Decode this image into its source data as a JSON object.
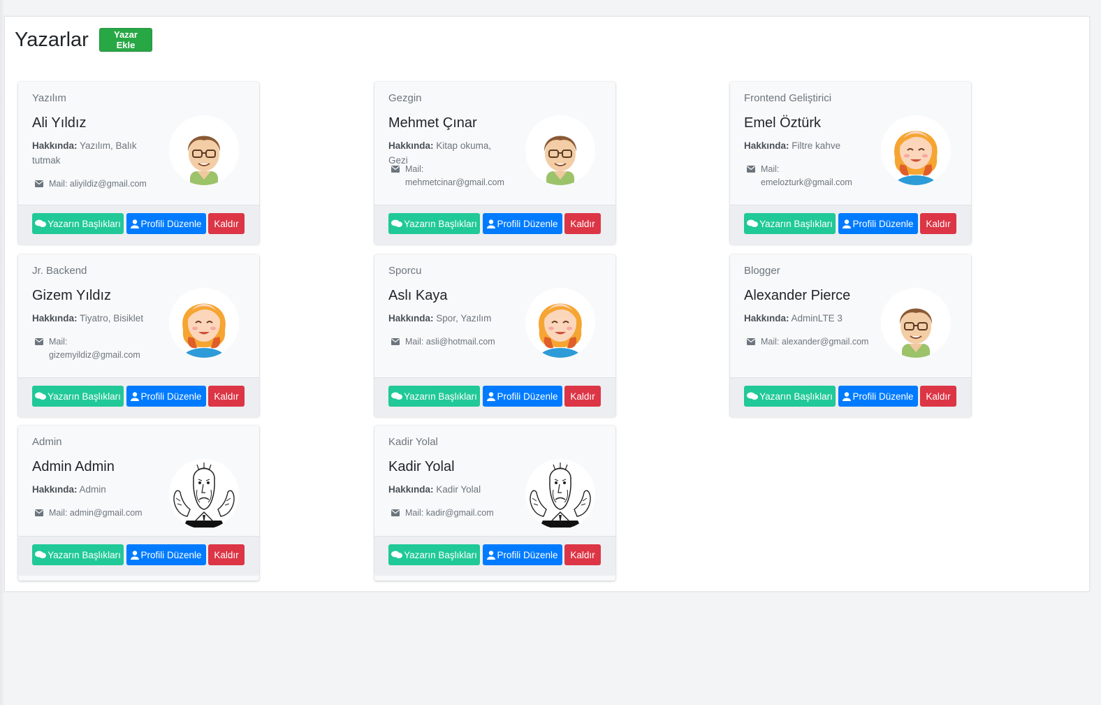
{
  "page": {
    "title": "Yazarlar",
    "add_button_label": "Yazar Ekle"
  },
  "labels": {
    "about": "Hakkında:",
    "posts_button": "Yazarın Başlıkları",
    "edit_button": "Profili Düzenle",
    "remove_button": "Kaldır"
  },
  "colors": {
    "posts_button": "#20c997",
    "edit_button": "#007bff",
    "remove_button": "#dc3545",
    "add_button": "#28a745"
  },
  "authors": [
    {
      "role": "Yazılım",
      "name": "Ali Yıldız",
      "about": "Yazılım, Balık tutmak",
      "mail_label": "Mail:",
      "mail": "aliyildiz@gmail.com",
      "avatar": "boy-avatar-icon"
    },
    {
      "role": "Gezgin",
      "name": "Mehmet Çınar",
      "about": "Kitap okuma, Gezi",
      "mail_label": "Mail:",
      "mail": "mehmetcinar@gmail.com",
      "avatar": "boy-avatar-icon"
    },
    {
      "role": "Frontend Geliştirici",
      "name": "Emel Öztürk",
      "about": "Filtre kahve",
      "mail_label": "Mail:",
      "mail": "emelozturk@gmail.com",
      "avatar": "girl-avatar-icon"
    },
    {
      "role": "Jr. Backend",
      "name": "Gizem Yıldız",
      "about": "Tiyatro, Bisiklet",
      "mail_label": "Mail:",
      "mail": "gizemyildiz@gmail.com",
      "avatar": "girl-avatar-icon"
    },
    {
      "role": "Sporcu",
      "name": "Aslı Kaya",
      "about": "Spor, Yazılım",
      "mail_label": "Mail:",
      "mail": "asli@hotmail.com",
      "avatar": "girl-avatar-icon"
    },
    {
      "role": "Blogger",
      "name": "Alexander Pierce",
      "about": "AdminLTE 3",
      "mail_label": "Mail:",
      "mail": "alexander@gmail.com",
      "avatar": "boy-avatar-icon"
    },
    {
      "role": "Admin",
      "name": "Admin Admin",
      "about": "Admin",
      "mail_label": "Mail:",
      "mail": "admin@gmail.com",
      "avatar": "old-man-sketch-icon"
    },
    {
      "role": "Kadir Yolal",
      "name": "Kadir Yolal",
      "about": "Kadir Yolal",
      "mail_label": "Mail:",
      "mail": "kadir@gmail.com",
      "avatar": "old-man-sketch-icon"
    }
  ]
}
